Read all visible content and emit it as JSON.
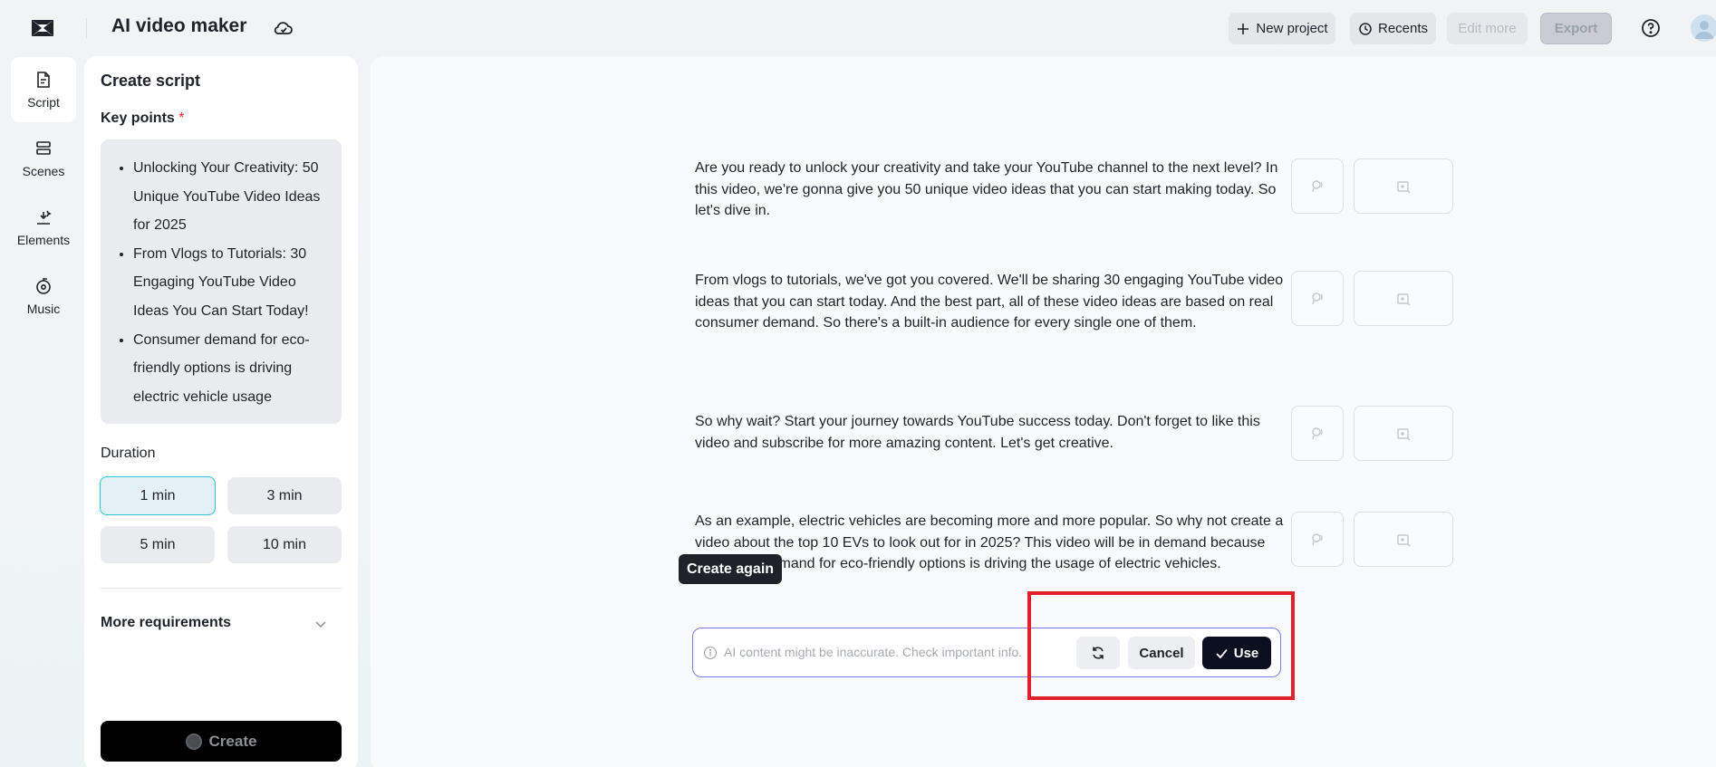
{
  "header": {
    "title": "AI video maker",
    "new_project": "New project",
    "recents": "Recents",
    "edit_more": "Edit more",
    "export": "Export"
  },
  "rail": {
    "items": [
      {
        "label": "Script",
        "icon": "script-icon",
        "active": true
      },
      {
        "label": "Scenes",
        "icon": "scenes-icon",
        "active": false
      },
      {
        "label": "Elements",
        "icon": "elements-icon",
        "active": false
      },
      {
        "label": "Music",
        "icon": "music-icon",
        "active": false
      }
    ]
  },
  "panel": {
    "title": "Create script",
    "key_points_label": "Key points",
    "required_mark": "*",
    "key_points": [
      "Unlocking Your Creativity: 50 Unique YouTube Video Ideas for 2025",
      "From Vlogs to Tutorials: 30 Engaging YouTube Video Ideas You Can Start Today!",
      "Consumer demand for eco-friendly options is driving electric vehicle usage"
    ],
    "duration_label": "Duration",
    "durations": [
      "1 min",
      "3 min",
      "5 min",
      "10 min"
    ],
    "selected_duration": "1 min",
    "more_requirements": "More requirements",
    "create": "Create"
  },
  "script": {
    "paragraphs": [
      "Are you ready to unlock your creativity and take your YouTube channel to the next level? In this video, we're gonna give you 50 unique video ideas that you can start making today. So let's dive in.",
      "From vlogs to tutorials, we've got you covered. We'll be sharing 30 engaging YouTube video ideas that you can start today. And the best part, all of these video ideas are based on real consumer demand. So there's a built-in audience for every single one of them.",
      "So why wait? Start your journey towards YouTube success today. Don't forget to like this video and subscribe for more amazing content. Let's get creative.",
      "As an example, electric vehicles are becoming more and more popular. So why not create a video about the top 10 EVs to look out for in 2025? This video will be in demand because consumer demand for eco-friendly options is driving the usage of electric vehicles."
    ]
  },
  "action_bar": {
    "notice": "AI content might be inaccurate. Check important info.",
    "cancel": "Cancel",
    "use": "Use",
    "tooltip": "Create again"
  },
  "colors": {
    "accent_border": "#7b7cf0",
    "selected_duration_border": "#2cc2d8",
    "highlight_box": "#e3202a",
    "use_button": "#0b0f1f"
  }
}
